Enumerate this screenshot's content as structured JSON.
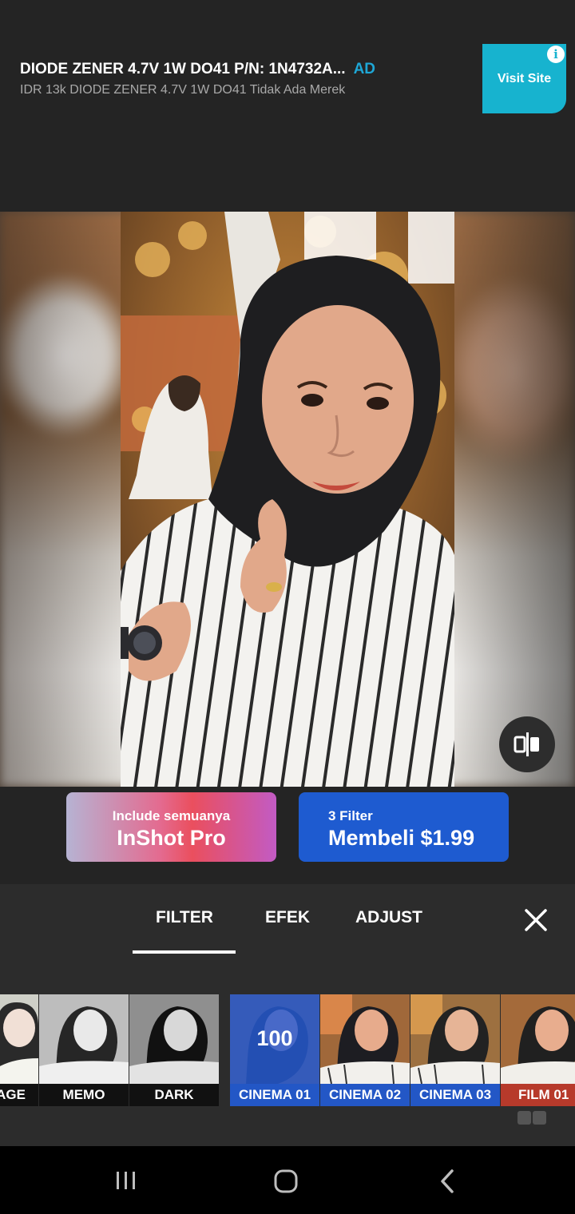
{
  "ad": {
    "title": "DIODE ZENER 4.7V 1W DO41 P/N: 1N4732A...",
    "badge": "AD",
    "subtitle": "IDR 13k DIODE ZENER 4.7V 1W DO41 Tidak Ada Merek",
    "cta": "Visit Site",
    "info_glyph": "i",
    "color_cta": "#17b3cf"
  },
  "purchase": {
    "pro_small": "Include semuanya",
    "pro_big": "InShot Pro",
    "buy_small": "3 Filter",
    "buy_big": "Membeli $1.99",
    "color_buy": "#1e5bd0"
  },
  "tabs": {
    "items": [
      "FILTER",
      "EFEK",
      "ADJUST"
    ],
    "active": "FILTER"
  },
  "filters": {
    "items": [
      {
        "label": "AGE",
        "style": "bw-light"
      },
      {
        "label": "MEMO",
        "style": "bw"
      },
      {
        "label": "DARK",
        "style": "bw-dark"
      },
      {
        "label": "CINEMA 01",
        "style": "selected",
        "strength": "100"
      },
      {
        "label": "CINEMA 02",
        "style": "color"
      },
      {
        "label": "CINEMA 03",
        "style": "color"
      },
      {
        "label": "FILM 01",
        "style": "film"
      }
    ],
    "selected_color": "#2357c6"
  },
  "icons": {
    "compare": "compare-icon",
    "close": "close-icon",
    "nav": [
      "recent-apps-icon",
      "home-icon",
      "back-icon"
    ]
  }
}
